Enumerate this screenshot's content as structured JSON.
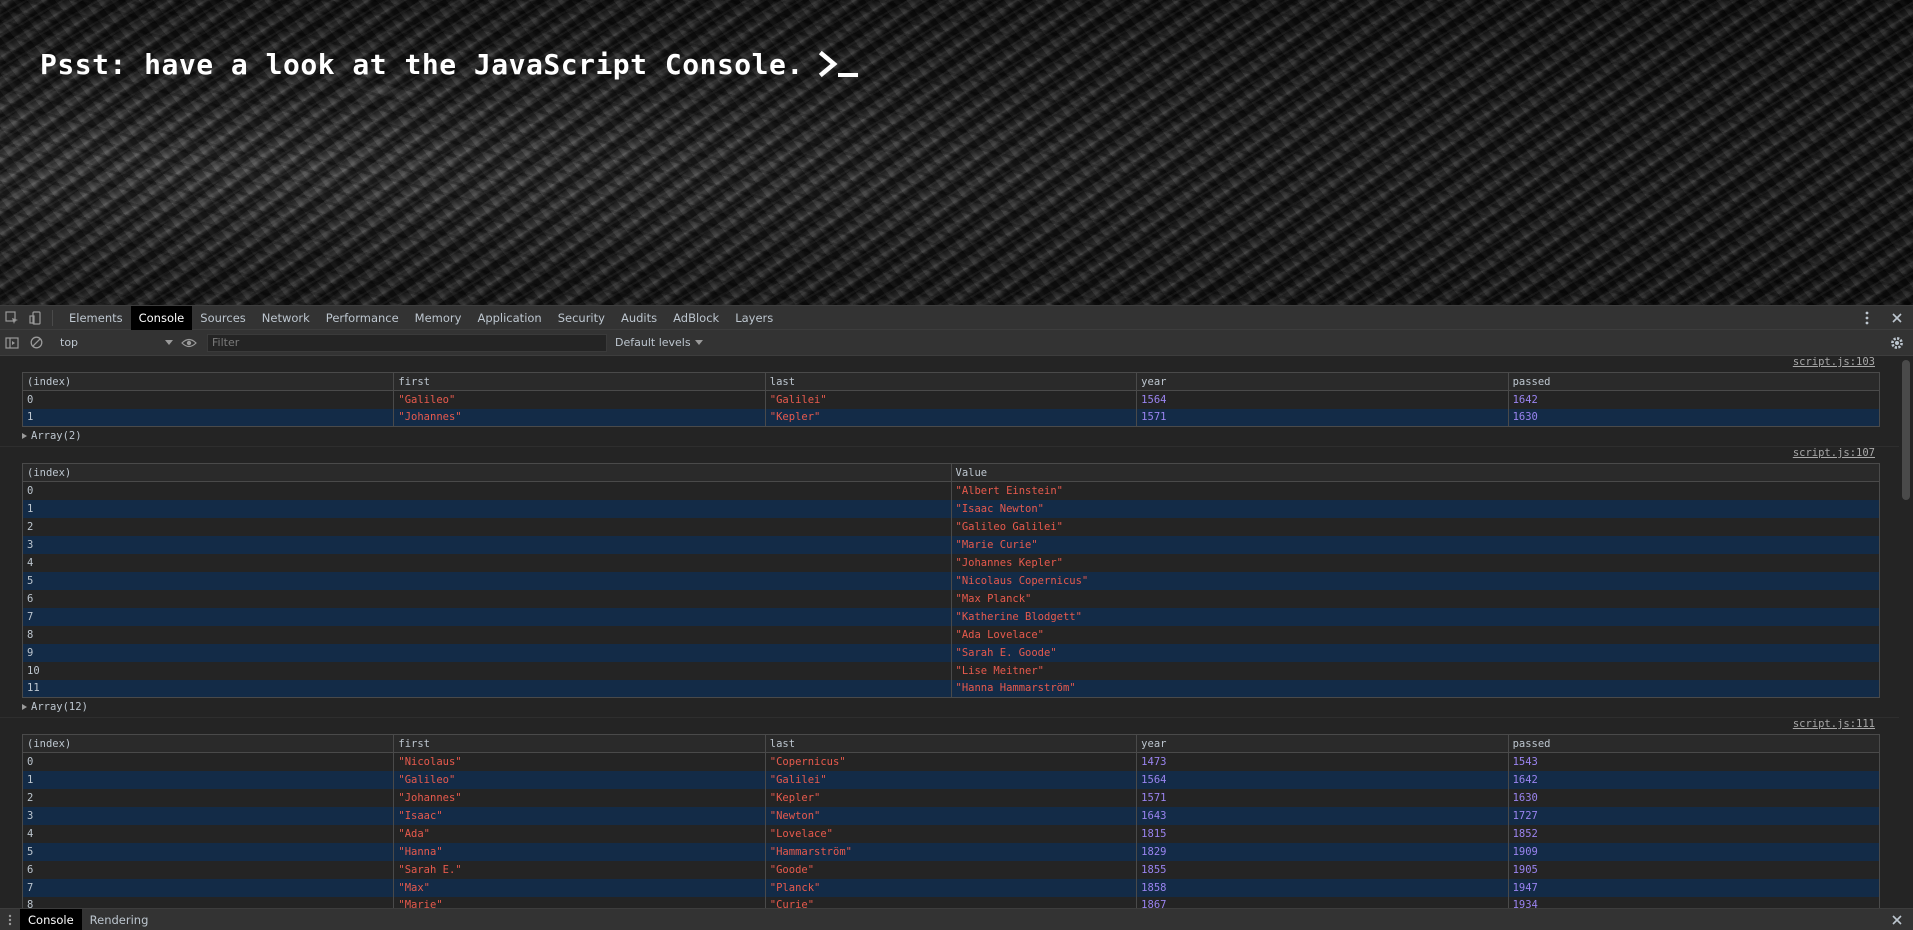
{
  "page": {
    "headline": "Psst: have a look at the JavaScript Console."
  },
  "devtools": {
    "tabs": [
      "Elements",
      "Console",
      "Sources",
      "Network",
      "Performance",
      "Memory",
      "Application",
      "Security",
      "Audits",
      "AdBlock",
      "Layers"
    ],
    "active_tab": "Console",
    "toolbar": {
      "context": "top",
      "filter_placeholder": "Filter",
      "levels": "Default levels"
    },
    "drawer": {
      "tabs": [
        "Console",
        "Rendering"
      ],
      "active_tab": "Console"
    }
  },
  "console": {
    "messages": [
      {
        "source": "script.js:103",
        "columns": [
          "(index)",
          "first",
          "last",
          "year",
          "passed"
        ],
        "rows": [
          [
            "0",
            "\"Galileo\"",
            "\"Galilei\"",
            "1564",
            "1642"
          ],
          [
            "1",
            "\"Johannes\"",
            "\"Kepler\"",
            "1571",
            "1630"
          ]
        ],
        "array_label": "Array(2)"
      },
      {
        "source": "script.js:107",
        "columns": [
          "(index)",
          "Value"
        ],
        "rows": [
          [
            "0",
            "\"Albert Einstein\""
          ],
          [
            "1",
            "\"Isaac Newton\""
          ],
          [
            "2",
            "\"Galileo Galilei\""
          ],
          [
            "3",
            "\"Marie Curie\""
          ],
          [
            "4",
            "\"Johannes Kepler\""
          ],
          [
            "5",
            "\"Nicolaus Copernicus\""
          ],
          [
            "6",
            "\"Max Planck\""
          ],
          [
            "7",
            "\"Katherine Blodgett\""
          ],
          [
            "8",
            "\"Ada Lovelace\""
          ],
          [
            "9",
            "\"Sarah E. Goode\""
          ],
          [
            "10",
            "\"Lise Meitner\""
          ],
          [
            "11",
            "\"Hanna Hammarström\""
          ]
        ],
        "array_label": "Array(12)"
      },
      {
        "source": "script.js:111",
        "columns": [
          "(index)",
          "first",
          "last",
          "year",
          "passed"
        ],
        "rows": [
          [
            "0",
            "\"Nicolaus\"",
            "\"Copernicus\"",
            "1473",
            "1543"
          ],
          [
            "1",
            "\"Galileo\"",
            "\"Galilei\"",
            "1564",
            "1642"
          ],
          [
            "2",
            "\"Johannes\"",
            "\"Kepler\"",
            "1571",
            "1630"
          ],
          [
            "3",
            "\"Isaac\"",
            "\"Newton\"",
            "1643",
            "1727"
          ],
          [
            "4",
            "\"Ada\"",
            "\"Lovelace\"",
            "1815",
            "1852"
          ],
          [
            "5",
            "\"Hanna\"",
            "\"Hammarström\"",
            "1829",
            "1909"
          ],
          [
            "6",
            "\"Sarah E.\"",
            "\"Goode\"",
            "1855",
            "1905"
          ],
          [
            "7",
            "\"Max\"",
            "\"Planck\"",
            "1858",
            "1947"
          ],
          [
            "8",
            "\"Marie\"",
            "\"Curie\"",
            "1867",
            "1934"
          ]
        ],
        "array_label": null
      }
    ]
  },
  "colors": {
    "string": "#e75a4d",
    "number": "#9a84f0",
    "alt_row": "#132b47",
    "panel": "#333333"
  }
}
